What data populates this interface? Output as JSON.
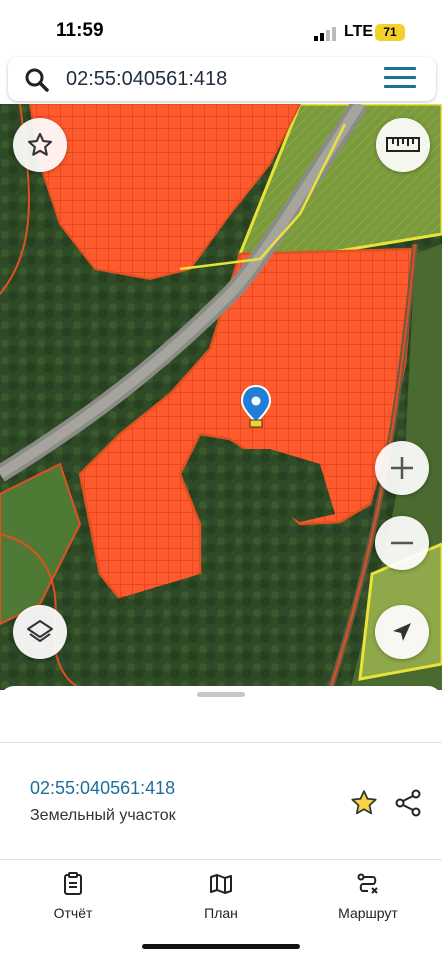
{
  "status_bar": {
    "time": "11:59",
    "network": "LTE",
    "battery": "71"
  },
  "search": {
    "query": "02:55:040561:418"
  },
  "map": {
    "icons": {
      "favorite": "star-outline-icon",
      "ruler": "ruler-icon",
      "zoom_in": "plus-icon",
      "zoom_out": "minus-icon",
      "layers": "layers-icon",
      "locate": "navigation-arrow-icon",
      "marker": "location-pin-icon"
    },
    "colors": {
      "parcel_fill": "#ff5a2e",
      "parcel_border": "#e05020",
      "boundary_yellow": "#e8e23a"
    }
  },
  "details": {
    "parcel_number": "02:55:040561:418",
    "parcel_type": "Земельный участок",
    "actions": [
      "star-icon",
      "share-icon"
    ]
  },
  "bottom_nav": {
    "items": [
      {
        "label": "Отчёт",
        "icon": "report-icon"
      },
      {
        "label": "План",
        "icon": "map-icon"
      },
      {
        "label": "Маршрут",
        "icon": "route-icon"
      }
    ]
  }
}
